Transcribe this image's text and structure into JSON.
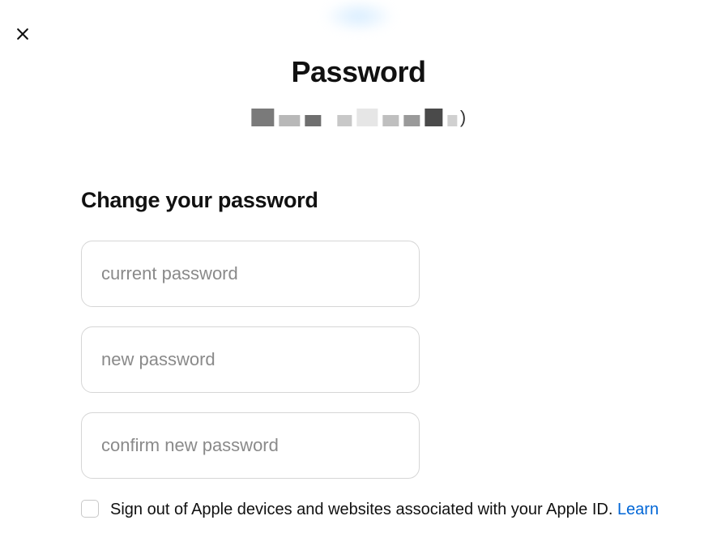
{
  "header": {
    "title": "Password"
  },
  "form": {
    "heading": "Change your password",
    "current_password_placeholder": "current password",
    "new_password_placeholder": "new password",
    "confirm_password_placeholder": "confirm new password"
  },
  "signout": {
    "label": "Sign out of Apple devices and websites associated with your Apple ID. ",
    "link_text": "Learn"
  }
}
